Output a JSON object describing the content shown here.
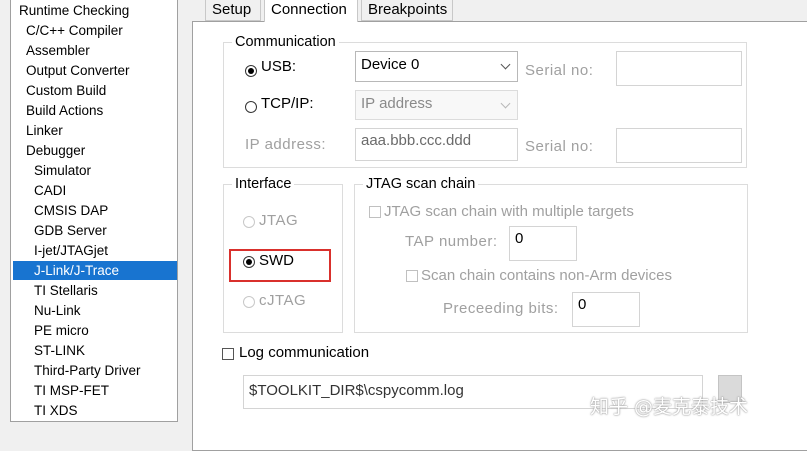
{
  "categories": {
    "items": [
      {
        "label": "Runtime Checking",
        "indent": 0
      },
      {
        "label": "C/C++ Compiler",
        "indent": 1
      },
      {
        "label": "Assembler",
        "indent": 1
      },
      {
        "label": "Output Converter",
        "indent": 1
      },
      {
        "label": "Custom Build",
        "indent": 1
      },
      {
        "label": "Build Actions",
        "indent": 1
      },
      {
        "label": "Linker",
        "indent": 1
      },
      {
        "label": "Debugger",
        "indent": 1
      },
      {
        "label": "Simulator",
        "indent": 2
      },
      {
        "label": "CADI",
        "indent": 2
      },
      {
        "label": "CMSIS DAP",
        "indent": 2
      },
      {
        "label": "GDB Server",
        "indent": 2
      },
      {
        "label": "I-jet/JTAGjet",
        "indent": 2
      },
      {
        "label": "J-Link/J-Trace",
        "indent": 2,
        "selected": true
      },
      {
        "label": "TI Stellaris",
        "indent": 2
      },
      {
        "label": "Nu-Link",
        "indent": 2
      },
      {
        "label": "PE micro",
        "indent": 2
      },
      {
        "label": "ST-LINK",
        "indent": 2
      },
      {
        "label": "Third-Party Driver",
        "indent": 2
      },
      {
        "label": "TI MSP-FET",
        "indent": 2
      },
      {
        "label": "TI XDS",
        "indent": 2
      }
    ],
    "selected_color": "#1874d0"
  },
  "tabs": [
    {
      "label": "Setup"
    },
    {
      "label": "Connection",
      "active": true
    },
    {
      "label": "Breakpoints"
    }
  ],
  "communication": {
    "title": "Communication",
    "usb": {
      "label": "USB:",
      "selected": true,
      "device_value": "Device 0",
      "serial_label": "Serial no:",
      "serial_value": ""
    },
    "tcpip": {
      "label": "TCP/IP:",
      "selected": false,
      "mode_value": "IP address"
    },
    "ip_address": {
      "label": "IP address:",
      "value": "aaa.bbb.ccc.ddd",
      "serial_label": "Serial no:",
      "serial_value": ""
    }
  },
  "interface": {
    "title": "Interface",
    "jtag": {
      "label": "JTAG",
      "enabled": false
    },
    "swd": {
      "label": "SWD",
      "selected": true
    },
    "cjtag": {
      "label": "cJTAG",
      "enabled": false
    },
    "highlight_color": "#d9302c"
  },
  "jtag_chain": {
    "title": "JTAG scan chain",
    "multiple_targets_label": "JTAG scan chain with multiple targets",
    "tap_number_label": "TAP number:",
    "tap_number_value": "0",
    "non_arm_label": "Scan chain contains non-Arm devices",
    "preceeding_bits_label": "Preceeding bits:",
    "preceeding_bits_value": "0"
  },
  "log": {
    "checkbox_label": "Log communication",
    "checked": false,
    "path_value": "$TOOLKIT_DIR$\\cspycomm.log"
  },
  "watermark": {
    "text": "知乎 @麦克泰技术"
  }
}
